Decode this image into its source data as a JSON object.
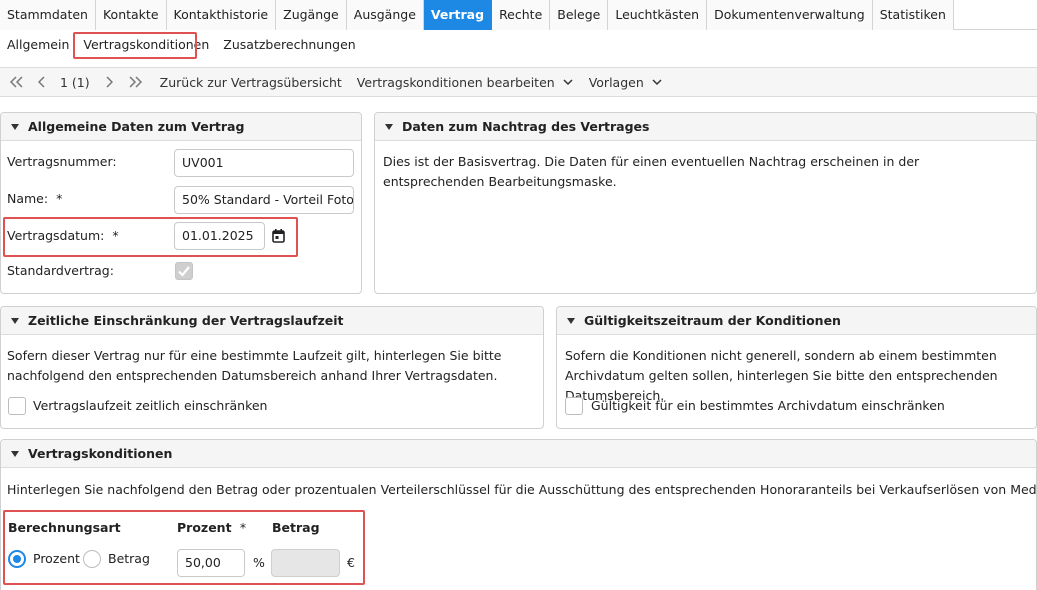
{
  "tabs": [
    "Stammdaten",
    "Kontakte",
    "Kontakthistorie",
    "Zugänge",
    "Ausgänge",
    "Vertrag",
    "Rechte",
    "Belege",
    "Leuchtkästen",
    "Dokumentenverwaltung",
    "Statistiken"
  ],
  "active_tab": "Vertrag",
  "subtabs": [
    "Allgemein",
    "Vertragskonditionen",
    "Zusatzberechnungen"
  ],
  "active_subtab": "Vertragskonditionen",
  "toolbar": {
    "first_icon": "double-chevron-left-icon",
    "prev_icon": "chevron-left-icon",
    "page_info": "1 (1)",
    "next_icon": "chevron-right-icon",
    "last_icon": "double-chevron-right-icon",
    "back_label": "Zurück zur Vertragsübersicht",
    "edit_label": "Vertragskonditionen bearbeiten",
    "templates_label": "Vorlagen"
  },
  "general_panel": {
    "title": "Allgemeine Daten zum Vertrag",
    "contract_number_label": "Vertragsnummer:",
    "contract_number_value": "UV001",
    "name_label": "Name:",
    "name_value": "50% Standard - Vorteil Foto",
    "date_label": "Vertragsdatum:",
    "date_value": "01.01.2025",
    "standard_label": "Standardvertrag:",
    "standard_checked": true,
    "required_mark": "*"
  },
  "amendment_panel": {
    "title": "Daten zum Nachtrag des Vertrages",
    "text": "Dies ist der Basisvertrag. Die Daten für einen eventuellen Nachtrag erscheinen in der entsprechenden Bearbeitungsmaske."
  },
  "term_panel": {
    "title": "Zeitliche Einschränkung der Vertragslaufzeit",
    "text": "Sofern dieser Vertrag nur für eine bestimmte Laufzeit gilt, hinterlegen Sie bitte nachfolgend den entsprechenden Datumsbereich anhand Ihrer Vertragsdaten.",
    "checkbox_label": "Vertragslaufzeit zeitlich einschränken"
  },
  "validity_panel": {
    "title": "Gültigkeitszeitraum der Konditionen",
    "text": "Sofern die Konditionen nicht generell, sondern ab einem bestimmten Archivdatum gelten sollen, hinterlegen Sie bitte den entsprechenden Datumsbereich.",
    "checkbox_label": "Gültigkeit für ein bestimmtes Archivdatum einschränken"
  },
  "conditions_panel": {
    "title": "Vertragskonditionen",
    "text": "Hinterlegen Sie nachfolgend den Betrag oder prozentualen Verteilerschlüssel für die Ausschüttung des entsprechenden Honoraranteils bei Verkaufserlösen von Medien.",
    "calc_type_label": "Berechnungsart",
    "percent_label": "Prozent",
    "amount_label": "Betrag",
    "radio_percent": "Prozent",
    "radio_amount": "Betrag",
    "percent_value": "50,00",
    "percent_unit": "%",
    "amount_value": "",
    "amount_unit": "€",
    "required_mark": "*"
  },
  "colors": {
    "accent": "#1e88e5",
    "highlight": "#e05252"
  }
}
